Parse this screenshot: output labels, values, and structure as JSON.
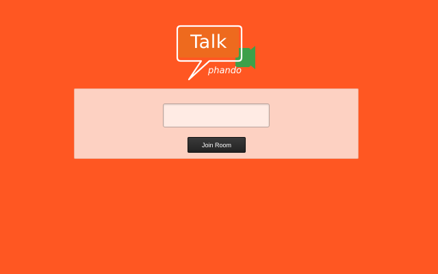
{
  "logo": {
    "title": "Talk",
    "subtitle": "phando",
    "icon": "video-camera-icon",
    "bubble_color": "#ee6a1e",
    "camera_color": "#3da04a"
  },
  "room": {
    "input_value": "",
    "input_placeholder": "",
    "join_label": "Join Room"
  },
  "colors": {
    "background": "#ff5722",
    "panel": "#fdd1c2",
    "input": "#ffebe4",
    "button": "#2b2b2b"
  }
}
